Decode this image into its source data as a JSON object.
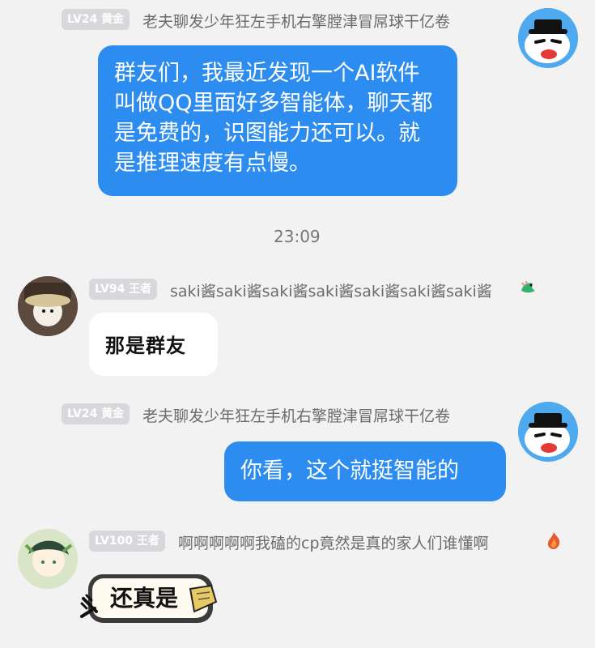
{
  "messages": [
    {
      "level": "LV24 黄金",
      "nickname": "老夫聊发少年狂左手机右擎膛津冒屌球干亿卷",
      "text": "群友们，我最近发现一个AI软件叫做QQ里面好多智能体，聊天都是免费的，识图能力还可以。就是推理速度有点慢。"
    },
    {
      "time": "23:09"
    },
    {
      "level": "LV94 王者",
      "nickname": "saki酱saki酱saki酱saki酱saki酱saki酱saki酱",
      "text": "那是群友"
    },
    {
      "level": "LV24 黄金",
      "nickname": "老夫聊发少年狂左手机右擎膛津冒屌球干亿卷",
      "text": "你看，这个就挺智能的"
    },
    {
      "level": "LV100 王者",
      "nickname": "啊啊啊啊啊我磕的cp竟然是真的家人们谁懂啊",
      "text": "还真是"
    }
  ]
}
